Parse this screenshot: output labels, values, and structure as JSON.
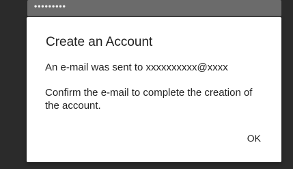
{
  "background": {
    "password_mask": "•••••••••"
  },
  "dialog": {
    "title": "Create an Account",
    "message_sent": "An e-mail was sent to xxxxxxxxxx@xxxx",
    "message_confirm": "Confirm the e-mail to complete the creation of the account.",
    "ok_label": "OK"
  },
  "colors": {
    "backdrop": "#2b2b2b",
    "dialog_background": "#ffffff",
    "text": "#1f1f1f"
  }
}
